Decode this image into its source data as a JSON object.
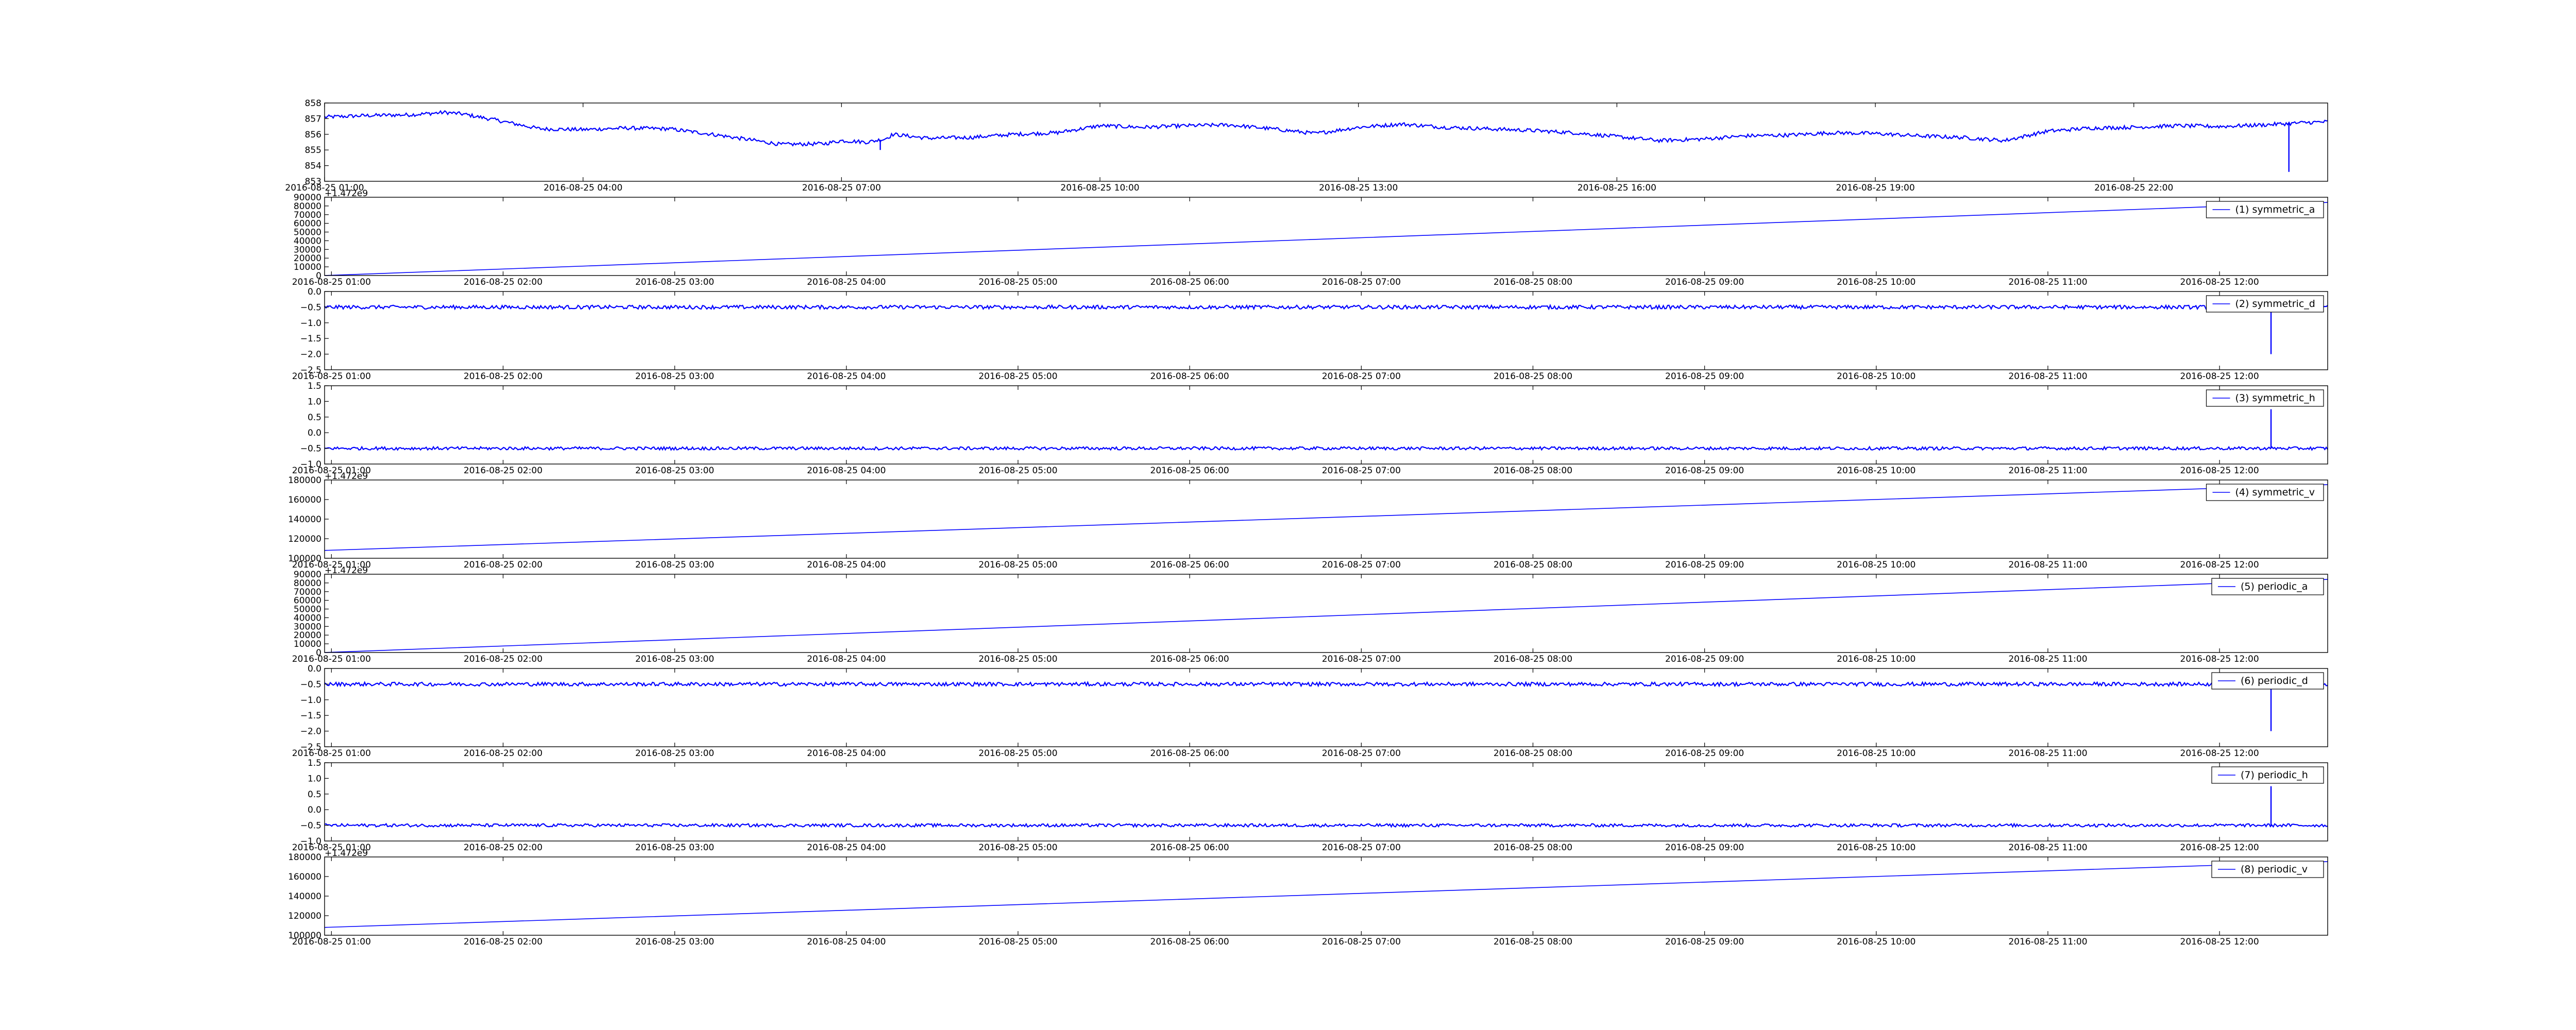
{
  "chart_data": [
    {
      "type": "line",
      "title": "",
      "xlabel": "",
      "ylabel": "",
      "x_ticks": [
        "2016-08-25 01:00",
        "2016-08-25 04:00",
        "2016-08-25 07:00",
        "2016-08-25 10:00",
        "2016-08-25 13:00",
        "2016-08-25 16:00",
        "2016-08-25 19:00",
        "2016-08-25 22:00"
      ],
      "x_tick_hours": [
        1,
        4,
        7,
        10,
        13,
        16,
        19,
        22
      ],
      "xlim_hours": [
        1,
        24.25
      ],
      "y_ticks": [
        "853",
        "854",
        "855",
        "856",
        "857",
        "858"
      ],
      "ylim": [
        853,
        858
      ],
      "offset_label": "",
      "legend": "",
      "color": "#0000ff",
      "series": [
        {
          "name": "",
          "x_hours": [
            1.0,
            1.5,
            2.0,
            2.4,
            2.6,
            3.0,
            3.5,
            4.0,
            4.5,
            5.0,
            5.5,
            6.0,
            6.3,
            6.8,
            7.0,
            7.3,
            7.5,
            7.6,
            8.0,
            8.5,
            9.0,
            9.5,
            10.0,
            10.5,
            11.0,
            11.5,
            12.0,
            12.5,
            13.0,
            13.5,
            14.0,
            14.5,
            15.0,
            15.5,
            16.0,
            16.5,
            17.0,
            17.5,
            18.0,
            18.5,
            19.0,
            19.5,
            20.0,
            20.5,
            21.0,
            21.5,
            22.0,
            22.5,
            23.0,
            23.5,
            24.0,
            24.25
          ],
          "values": [
            857.1,
            857.2,
            857.25,
            857.4,
            857.3,
            856.9,
            856.35,
            856.3,
            856.4,
            856.35,
            856.0,
            855.6,
            855.35,
            855.4,
            855.6,
            855.5,
            855.7,
            856.0,
            855.75,
            855.8,
            856.0,
            856.1,
            856.55,
            856.45,
            856.55,
            856.6,
            856.35,
            856.05,
            856.45,
            856.65,
            856.45,
            856.35,
            856.25,
            856.1,
            855.85,
            855.6,
            855.7,
            855.9,
            855.95,
            856.1,
            856.05,
            855.9,
            855.8,
            855.6,
            856.2,
            856.4,
            856.45,
            856.55,
            856.5,
            856.6,
            856.75,
            856.8
          ],
          "noise": 0.12,
          "spikes": [
            {
              "x_hours": 23.8,
              "value": 853.6
            },
            {
              "x_hours": 7.45,
              "value": 855.0
            }
          ]
        }
      ]
    },
    {
      "type": "line",
      "title": "",
      "xlabel": "",
      "ylabel": "",
      "x_ticks": [
        "2016-08-25 01:00",
        "2016-08-25 02:00",
        "2016-08-25 03:00",
        "2016-08-25 04:00",
        "2016-08-25 05:00",
        "2016-08-25 06:00",
        "2016-08-25 07:00",
        "2016-08-25 08:00",
        "2016-08-25 09:00",
        "2016-08-25 10:00",
        "2016-08-25 11:00",
        "2016-08-25 12:00"
      ],
      "x_tick_hours": [
        1,
        2,
        3,
        4,
        5,
        6,
        7,
        8,
        9,
        10,
        11,
        12
      ],
      "xlim_hours": [
        0.96,
        12.63
      ],
      "y_ticks": [
        "0",
        "10000",
        "20000",
        "30000",
        "40000",
        "50000",
        "60000",
        "70000",
        "80000",
        "90000"
      ],
      "ylim": [
        0,
        90000
      ],
      "offset_label": "+1.472e9",
      "legend": "(1) symmetric_a",
      "color": "#0000ff",
      "series": [
        {
          "name": "(1) symmetric_a",
          "x_hours": [
            0.96,
            12.63
          ],
          "values": [
            0,
            84000
          ],
          "noise": 0,
          "spikes": []
        }
      ]
    },
    {
      "type": "line",
      "title": "",
      "xlabel": "",
      "ylabel": "",
      "x_ticks": [
        "2016-08-25 01:00",
        "2016-08-25 02:00",
        "2016-08-25 03:00",
        "2016-08-25 04:00",
        "2016-08-25 05:00",
        "2016-08-25 06:00",
        "2016-08-25 07:00",
        "2016-08-25 08:00",
        "2016-08-25 09:00",
        "2016-08-25 10:00",
        "2016-08-25 11:00",
        "2016-08-25 12:00"
      ],
      "x_tick_hours": [
        1,
        2,
        3,
        4,
        5,
        6,
        7,
        8,
        9,
        10,
        11,
        12
      ],
      "xlim_hours": [
        0.96,
        12.63
      ],
      "y_ticks": [
        "−2.5",
        "−2.0",
        "−1.5",
        "−1.0",
        "−0.5",
        "0.0"
      ],
      "ylim": [
        -2.5,
        0
      ],
      "offset_label": "",
      "legend": "(2) symmetric_d",
      "color": "#0000ff",
      "series": [
        {
          "name": "(2) symmetric_d",
          "x_hours": [
            0.96,
            12.63
          ],
          "values": [
            -0.5,
            -0.5
          ],
          "noise": 0.06,
          "spikes": [
            {
              "x_hours": 12.3,
              "value": -2.0
            }
          ]
        }
      ]
    },
    {
      "type": "line",
      "title": "",
      "xlabel": "",
      "ylabel": "",
      "x_ticks": [
        "2016-08-25 01:00",
        "2016-08-25 02:00",
        "2016-08-25 03:00",
        "2016-08-25 04:00",
        "2016-08-25 05:00",
        "2016-08-25 06:00",
        "2016-08-25 07:00",
        "2016-08-25 08:00",
        "2016-08-25 09:00",
        "2016-08-25 10:00",
        "2016-08-25 11:00",
        "2016-08-25 12:00"
      ],
      "x_tick_hours": [
        1,
        2,
        3,
        4,
        5,
        6,
        7,
        8,
        9,
        10,
        11,
        12
      ],
      "xlim_hours": [
        0.96,
        12.63
      ],
      "y_ticks": [
        "−1.0",
        "−0.5",
        "0.0",
        "0.5",
        "1.0",
        "1.5"
      ],
      "ylim": [
        -1.0,
        1.5
      ],
      "offset_label": "",
      "legend": "(3) symmetric_h",
      "color": "#0000ff",
      "series": [
        {
          "name": "(3) symmetric_h",
          "x_hours": [
            0.96,
            12.63
          ],
          "values": [
            -0.5,
            -0.5
          ],
          "noise": 0.05,
          "spikes": [
            {
              "x_hours": 12.3,
              "value": 0.75
            }
          ]
        }
      ]
    },
    {
      "type": "line",
      "title": "",
      "xlabel": "",
      "ylabel": "",
      "x_ticks": [
        "2016-08-25 01:00",
        "2016-08-25 02:00",
        "2016-08-25 03:00",
        "2016-08-25 04:00",
        "2016-08-25 05:00",
        "2016-08-25 06:00",
        "2016-08-25 07:00",
        "2016-08-25 08:00",
        "2016-08-25 09:00",
        "2016-08-25 10:00",
        "2016-08-25 11:00",
        "2016-08-25 12:00"
      ],
      "x_tick_hours": [
        1,
        2,
        3,
        4,
        5,
        6,
        7,
        8,
        9,
        10,
        11,
        12
      ],
      "xlim_hours": [
        0.96,
        12.63
      ],
      "y_ticks": [
        "100000",
        "120000",
        "140000",
        "160000",
        "180000"
      ],
      "ylim": [
        90000,
        190000
      ],
      "offset_label": "+1.472e9",
      "legend": "(4) symmetric_v",
      "color": "#0000ff",
      "series": [
        {
          "name": "(4) symmetric_v",
          "x_hours": [
            0.96,
            12.63
          ],
          "values": [
            100000,
            184000
          ],
          "noise": 0,
          "spikes": []
        }
      ]
    },
    {
      "type": "line",
      "title": "",
      "xlabel": "",
      "ylabel": "",
      "x_ticks": [
        "2016-08-25 01:00",
        "2016-08-25 02:00",
        "2016-08-25 03:00",
        "2016-08-25 04:00",
        "2016-08-25 05:00",
        "2016-08-25 06:00",
        "2016-08-25 07:00",
        "2016-08-25 08:00",
        "2016-08-25 09:00",
        "2016-08-25 10:00",
        "2016-08-25 11:00",
        "2016-08-25 12:00"
      ],
      "x_tick_hours": [
        1,
        2,
        3,
        4,
        5,
        6,
        7,
        8,
        9,
        10,
        11,
        12
      ],
      "xlim_hours": [
        0.96,
        12.63
      ],
      "y_ticks": [
        "0",
        "10000",
        "20000",
        "30000",
        "40000",
        "50000",
        "60000",
        "70000",
        "80000",
        "90000"
      ],
      "ylim": [
        0,
        90000
      ],
      "offset_label": "+1.472e9",
      "legend": "(5) periodic_a",
      "color": "#0000ff",
      "series": [
        {
          "name": "(5) periodic_a",
          "x_hours": [
            0.96,
            12.63
          ],
          "values": [
            0,
            84000
          ],
          "noise": 0,
          "spikes": []
        }
      ]
    },
    {
      "type": "line",
      "title": "",
      "xlabel": "",
      "ylabel": "",
      "x_ticks": [
        "2016-08-25 01:00",
        "2016-08-25 02:00",
        "2016-08-25 03:00",
        "2016-08-25 04:00",
        "2016-08-25 05:00",
        "2016-08-25 06:00",
        "2016-08-25 07:00",
        "2016-08-25 08:00",
        "2016-08-25 09:00",
        "2016-08-25 10:00",
        "2016-08-25 11:00",
        "2016-08-25 12:00"
      ],
      "x_tick_hours": [
        1,
        2,
        3,
        4,
        5,
        6,
        7,
        8,
        9,
        10,
        11,
        12
      ],
      "xlim_hours": [
        0.96,
        12.63
      ],
      "y_ticks": [
        "−2.5",
        "−2.0",
        "−1.5",
        "−1.0",
        "−0.5",
        "0.0"
      ],
      "ylim": [
        -2.5,
        0
      ],
      "offset_label": "",
      "legend": "(6) periodic_d",
      "color": "#0000ff",
      "series": [
        {
          "name": "(6) periodic_d",
          "x_hours": [
            0.96,
            12.63
          ],
          "values": [
            -0.5,
            -0.5
          ],
          "noise": 0.06,
          "spikes": [
            {
              "x_hours": 12.3,
              "value": -2.0
            }
          ]
        }
      ]
    },
    {
      "type": "line",
      "title": "",
      "xlabel": "",
      "ylabel": "",
      "x_ticks": [
        "2016-08-25 01:00",
        "2016-08-25 02:00",
        "2016-08-25 03:00",
        "2016-08-25 04:00",
        "2016-08-25 05:00",
        "2016-08-25 06:00",
        "2016-08-25 07:00",
        "2016-08-25 08:00",
        "2016-08-25 09:00",
        "2016-08-25 10:00",
        "2016-08-25 11:00",
        "2016-08-25 12:00"
      ],
      "x_tick_hours": [
        1,
        2,
        3,
        4,
        5,
        6,
        7,
        8,
        9,
        10,
        11,
        12
      ],
      "xlim_hours": [
        0.96,
        12.63
      ],
      "y_ticks": [
        "−1.0",
        "−0.5",
        "0.0",
        "0.5",
        "1.0",
        "1.5"
      ],
      "ylim": [
        -1.0,
        1.5
      ],
      "offset_label": "",
      "legend": "(7) periodic_h",
      "color": "#0000ff",
      "series": [
        {
          "name": "(7) periodic_h",
          "x_hours": [
            0.96,
            12.63
          ],
          "values": [
            -0.5,
            -0.5
          ],
          "noise": 0.05,
          "spikes": [
            {
              "x_hours": 12.3,
              "value": 0.75
            }
          ]
        }
      ]
    },
    {
      "type": "line",
      "title": "",
      "xlabel": "",
      "ylabel": "",
      "x_ticks": [
        "2016-08-25 01:00",
        "2016-08-25 02:00",
        "2016-08-25 03:00",
        "2016-08-25 04:00",
        "2016-08-25 05:00",
        "2016-08-25 06:00",
        "2016-08-25 07:00",
        "2016-08-25 08:00",
        "2016-08-25 09:00",
        "2016-08-25 10:00",
        "2016-08-25 11:00",
        "2016-08-25 12:00"
      ],
      "x_tick_hours": [
        1,
        2,
        3,
        4,
        5,
        6,
        7,
        8,
        9,
        10,
        11,
        12
      ],
      "xlim_hours": [
        0.96,
        12.63
      ],
      "y_ticks": [
        "100000",
        "120000",
        "140000",
        "160000",
        "180000"
      ],
      "ylim": [
        90000,
        190000
      ],
      "offset_label": "+1.472e9",
      "legend": "(8) periodic_v",
      "color": "#0000ff",
      "series": [
        {
          "name": "(8) periodic_v",
          "x_hours": [
            0.96,
            12.63
          ],
          "values": [
            100000,
            184000
          ],
          "noise": 0,
          "spikes": []
        }
      ]
    }
  ]
}
